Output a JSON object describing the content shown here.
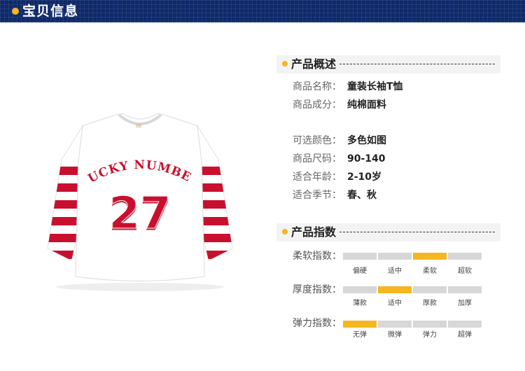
{
  "header": {
    "title": "宝贝信息"
  },
  "product_image": {
    "chest_text": "LUCKY NUMBER",
    "number": "27",
    "tag": "BB",
    "colors": {
      "body": "#ffffff",
      "stripe": "#c8102e"
    }
  },
  "overview": {
    "title": "产品概述",
    "rows": [
      {
        "label": "商品名称：",
        "value": "童装长袖T恤"
      },
      {
        "label": "商品成分：",
        "value": "纯棉面料"
      },
      {
        "label": "可选颜色：",
        "value": "多色如图"
      },
      {
        "label": "商品尺码：",
        "value": "90-140"
      },
      {
        "label": "适合年龄：",
        "value": "2-10岁"
      },
      {
        "label": "适合季节：",
        "value": "春、秋"
      }
    ]
  },
  "indices": {
    "title": "产品指数",
    "items": [
      {
        "label": "柔软指数：",
        "options": [
          "偏硬",
          "适中",
          "柔软",
          "超软"
        ],
        "selected": 2
      },
      {
        "label": "厚度指数：",
        "options": [
          "薄款",
          "适中",
          "厚款",
          "加厚"
        ],
        "selected": 1
      },
      {
        "label": "弹力指数：",
        "options": [
          "无弹",
          "微弹",
          "弹力",
          "超弹"
        ],
        "selected": 0
      }
    ]
  },
  "colors": {
    "accent": "#f5b620",
    "header_bg": "#0f2a6b",
    "inactive_bar": "#d7d7d7"
  }
}
